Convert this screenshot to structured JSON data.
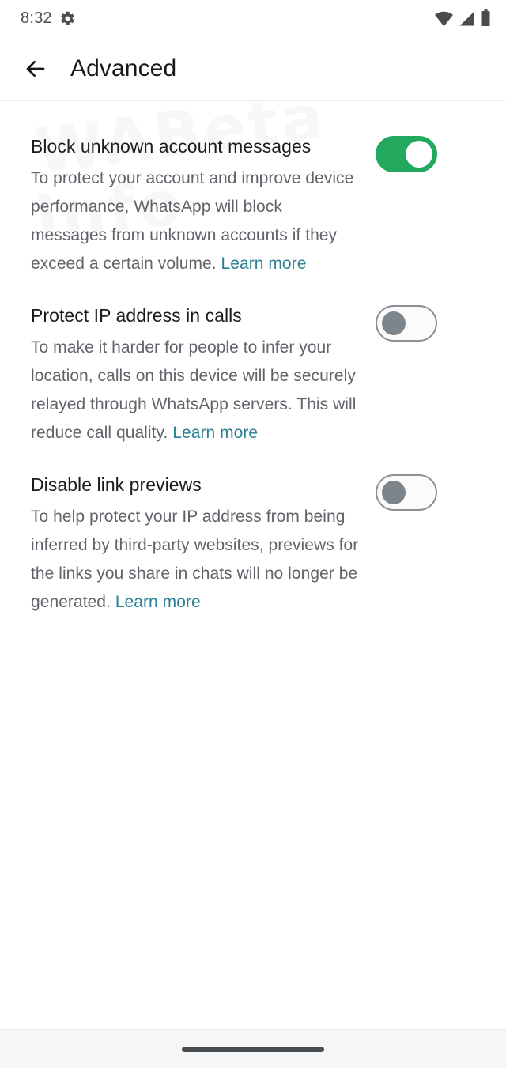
{
  "status_bar": {
    "time": "8:32",
    "icons": [
      "gear-icon",
      "wifi-icon",
      "cellular-signal-icon",
      "battery-icon"
    ]
  },
  "app_bar": {
    "back_label": "Back",
    "title": "Advanced"
  },
  "colors": {
    "switch_on": "#23a95e",
    "switch_off_track": "#8a9097",
    "switch_off_knob": "#7d858c",
    "link": "#2a7f93",
    "title_text": "#1b1c1e",
    "body_text": "#60646a",
    "nav_bar_bg": "#f5f6f7"
  },
  "settings": [
    {
      "title": "Block unknown account messages",
      "description": "To protect your account and improve device performance, WhatsApp will block messages from unknown accounts if they exceed a certain volume. ",
      "link_label": "Learn more",
      "link_inline": true,
      "toggle_state": "on"
    },
    {
      "title": "Protect IP address in calls",
      "description": "To make it harder for people to infer your location, calls on this device will be securely relayed through WhatsApp servers. This will reduce call quality. ",
      "link_label": "Learn more",
      "link_inline": false,
      "toggle_state": "off"
    },
    {
      "title": "Disable link previews",
      "description": "To help protect your IP address from being inferred by third-party websites, previews for the links you share in chats will no longer be generated. ",
      "link_label": "Learn more",
      "link_inline": true,
      "toggle_state": "off"
    }
  ],
  "watermark": {
    "line1": "WABeta",
    "line2": "Info"
  },
  "nav_bar": {
    "gesture_pill_label": "Home gesture bar"
  }
}
